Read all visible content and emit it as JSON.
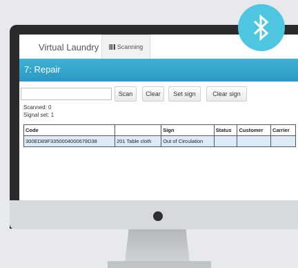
{
  "tabs": {
    "brand": "Virtual Laundry",
    "scanning": "Scanning"
  },
  "header": {
    "title": "7: Repair"
  },
  "toolbar": {
    "search_placeholder": "",
    "scan_label": "Scan",
    "clear_label": "Clear",
    "set_sign_label": "Set sign",
    "clear_sign_label": "Clear sign"
  },
  "stats": {
    "scanned": "Scanned: 0",
    "signal_set": "Signal set: 1"
  },
  "table": {
    "headers": [
      "Code",
      "",
      "Sign",
      "Status",
      "Customer",
      "Carrier"
    ],
    "rows": [
      [
        "300ED89F3350004000679D38",
        "201 Table cloth",
        "Out of Circulation",
        "",
        "",
        ""
      ]
    ]
  },
  "colors": {
    "accent": "#2fa4cf",
    "badge": "#4fc6e0"
  },
  "icons": {
    "badge": "bluetooth-icon",
    "tab": "barcode-icon"
  }
}
